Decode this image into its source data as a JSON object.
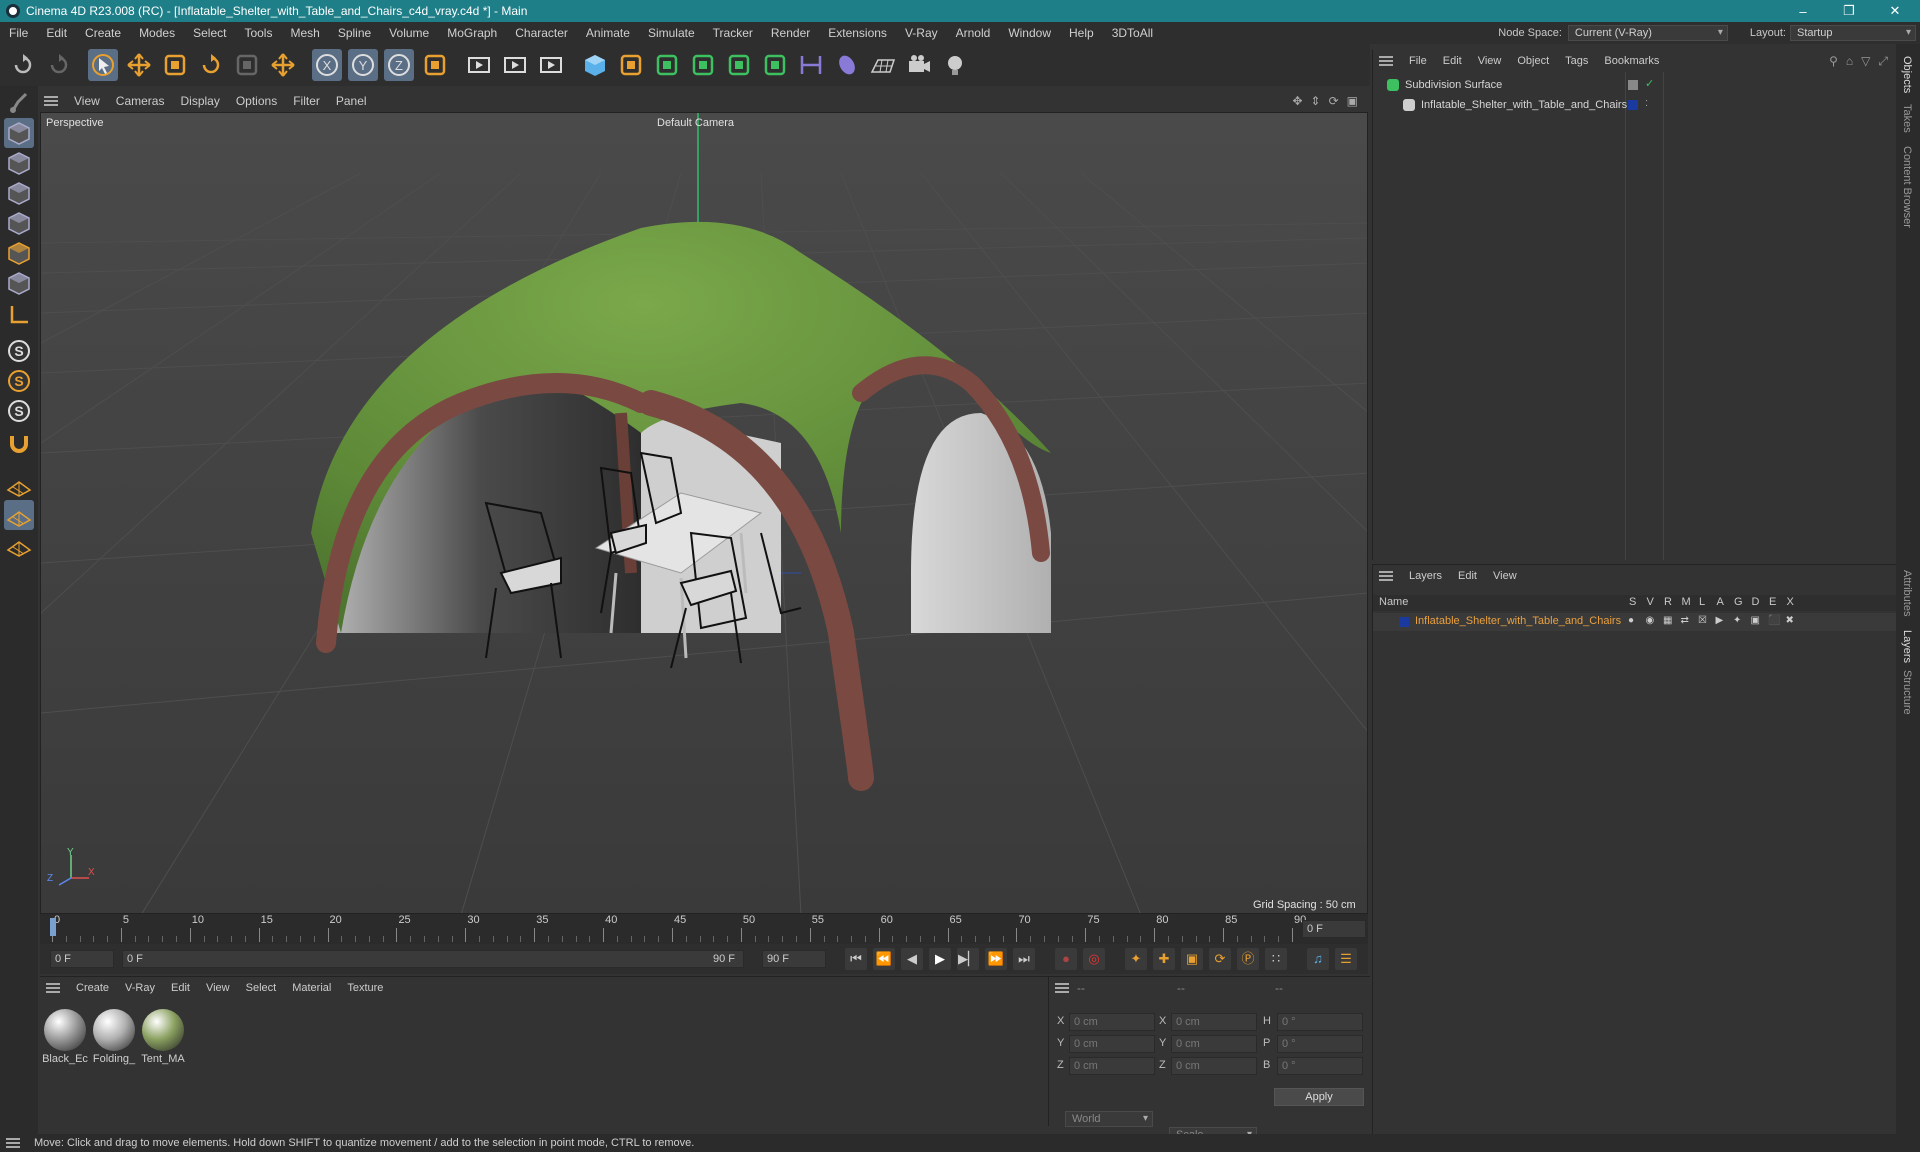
{
  "window": {
    "title": "Cinema 4D R23.008 (RC) - [Inflatable_Shelter_with_Table_and_Chairs_c4d_vray.c4d *] - Main",
    "minimize": "–",
    "restore": "❐",
    "close": "✕"
  },
  "menu": [
    "File",
    "Edit",
    "Create",
    "Modes",
    "Select",
    "Tools",
    "Mesh",
    "Spline",
    "Volume",
    "MoGraph",
    "Character",
    "Animate",
    "Simulate",
    "Tracker",
    "Render",
    "Extensions",
    "V-Ray",
    "Arnold",
    "Window",
    "Help",
    "3DToAll"
  ],
  "node_space": {
    "label": "Node Space:",
    "value": "Current (V-Ray)"
  },
  "layout": {
    "label": "Layout:",
    "value": "Startup"
  },
  "toolbar_icons": [
    "undo-icon",
    "redo-icon",
    "select-icon",
    "move-icon",
    "scale-icon",
    "rotate-icon",
    "live-select-icon",
    "transform-icon",
    "x-axis-icon",
    "y-axis-icon",
    "z-axis-icon",
    "coordinate-system-icon",
    "render-region-icon",
    "render-view-icon",
    "render-settings-icon",
    "cube-icon",
    "pen-icon",
    "subdivision-icon",
    "extrude-icon",
    "cloner-icon",
    "mograph-icon",
    "symmetry-icon",
    "deformer-icon",
    "floor-icon",
    "camera-icon",
    "light-icon"
  ],
  "viewport": {
    "menu": [
      "View",
      "Cameras",
      "Display",
      "Options",
      "Filter",
      "Panel"
    ],
    "projection": "Perspective",
    "camera": "Default Camera",
    "grid_spacing": "Grid Spacing : 50 cm",
    "axis_x": "X",
    "axis_y": "Y",
    "axis_z": "Z"
  },
  "timeline": {
    "ticks": [
      "0",
      "5",
      "10",
      "15",
      "20",
      "25",
      "30",
      "35",
      "40",
      "45",
      "50",
      "55",
      "60",
      "65",
      "70",
      "75",
      "80",
      "85",
      "90"
    ],
    "current_frame": "0 F",
    "end_field": "0 F"
  },
  "transport": {
    "start": "0 F",
    "range_start": "0 F",
    "range_end": "90 F",
    "end": "90 F"
  },
  "materials": {
    "menu": [
      "Create",
      "V-Ray",
      "Edit",
      "View",
      "Select",
      "Material",
      "Texture"
    ],
    "items": [
      {
        "name": "Black_Ec",
        "color": "#9a9a9a"
      },
      {
        "name": "Folding_",
        "color": "#b0b0b0"
      },
      {
        "name": "Tent_MA",
        "color": "#8aa060"
      }
    ]
  },
  "coordinates": {
    "headers": [
      "--",
      "--",
      "--"
    ],
    "rows": [
      {
        "l1": "X",
        "v1": "0 cm",
        "l2": "X",
        "v2": "0 cm",
        "l3": "H",
        "v3": "0 °"
      },
      {
        "l1": "Y",
        "v1": "0 cm",
        "l2": "Y",
        "v2": "0 cm",
        "l3": "P",
        "v3": "0 °"
      },
      {
        "l1": "Z",
        "v1": "0 cm",
        "l2": "Z",
        "v2": "0 cm",
        "l3": "B",
        "v3": "0 °"
      }
    ],
    "mode": "World",
    "transform": "Scale",
    "apply": "Apply"
  },
  "objects": {
    "menu": [
      "File",
      "Edit",
      "View",
      "Object",
      "Tags",
      "Bookmarks"
    ],
    "items": [
      {
        "name": "Subdivision Surface"
      },
      {
        "name": "Inflatable_Shelter_with_Table_and_Chairs"
      }
    ]
  },
  "layers": {
    "menu": [
      "Layers",
      "Edit",
      "View"
    ],
    "col_name": "Name",
    "cols": [
      "S",
      "V",
      "R",
      "M",
      "L",
      "A",
      "G",
      "D",
      "E",
      "X"
    ],
    "items": [
      {
        "name": "Inflatable_Shelter_with_Table_and_Chairs",
        "color": "#1a3aa0"
      }
    ]
  },
  "side_tabs": [
    "Objects",
    "Takes",
    "Content Browser",
    "Attributes",
    "Layers",
    "Structure"
  ],
  "status": "Move: Click and drag to move elements. Hold down SHIFT to quantize movement / add to the selection in point mode, CTRL to remove.",
  "colors": {
    "accent": "#1f7f88",
    "layer_text": "#e8a040",
    "selection": "#5a6e86"
  }
}
